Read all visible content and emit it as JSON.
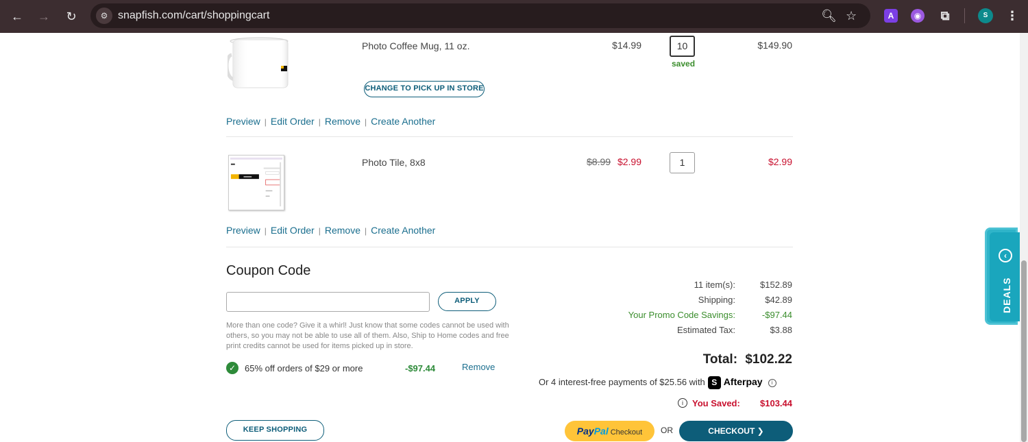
{
  "browser": {
    "url": "snapfish.com/cart/shoppingcart",
    "profile_initial": "S",
    "ext_a_label": "A"
  },
  "cart": {
    "items": [
      {
        "name": "Photo Coffee Mug, 11 oz.",
        "price": "$14.99",
        "quantity": "10",
        "qty_status": "saved",
        "line_total": "$149.90",
        "pickup_button": "CHANGE TO PICK UP IN STORE",
        "actions": [
          "Preview",
          "Edit Order",
          "Remove",
          "Create Another"
        ]
      },
      {
        "name": "Photo Tile, 8x8",
        "original_price": "$8.99",
        "price": "$2.99",
        "quantity": "1",
        "line_total": "$2.99",
        "actions": [
          "Preview",
          "Edit Order",
          "Remove",
          "Create Another"
        ]
      }
    ]
  },
  "coupon": {
    "title": "Coupon Code",
    "input_value": "",
    "apply_label": "APPLY",
    "help_text": "More than one code? Give it a whirl! Just know that some codes cannot be used with others, so you may not be able to use all of them. Also, Ship to Home codes and free print credits cannot be used for items picked up in store.",
    "applied": {
      "description": "65% off orders of $29 or more",
      "amount": "-$97.44",
      "remove_label": "Remove"
    }
  },
  "summary": {
    "rows": [
      {
        "label": "11 item(s):",
        "value": "$152.89"
      },
      {
        "label": "Shipping:",
        "value": "$42.89"
      },
      {
        "label": "Your Promo Code Savings:",
        "value": "-$97.44"
      },
      {
        "label": "Estimated Tax:",
        "value": "$3.88"
      }
    ],
    "total_label": "Total:",
    "total_value": "$102.22",
    "afterpay_text": "Or 4 interest-free payments of $25.56 with",
    "afterpay_logo": "S",
    "afterpay_name": "Afterpay",
    "you_saved_label": "You Saved:",
    "you_saved_value": "$103.44"
  },
  "buttons": {
    "keep_shopping": "KEEP SHOPPING",
    "paypal_1": "Pay",
    "paypal_2": "Pal",
    "paypal_3": "Checkout",
    "or": "OR",
    "checkout": "CHECKOUT ❯"
  },
  "deals_tab": {
    "label": "DEALS"
  },
  "colors": {
    "brand_teal": "#0d5d79",
    "link": "#1a6e8e",
    "savings_green": "#3a8d2c",
    "sale_red": "#c8102e",
    "paypal_yellow": "#ffc439",
    "deals_teal": "#1aa6bd"
  }
}
